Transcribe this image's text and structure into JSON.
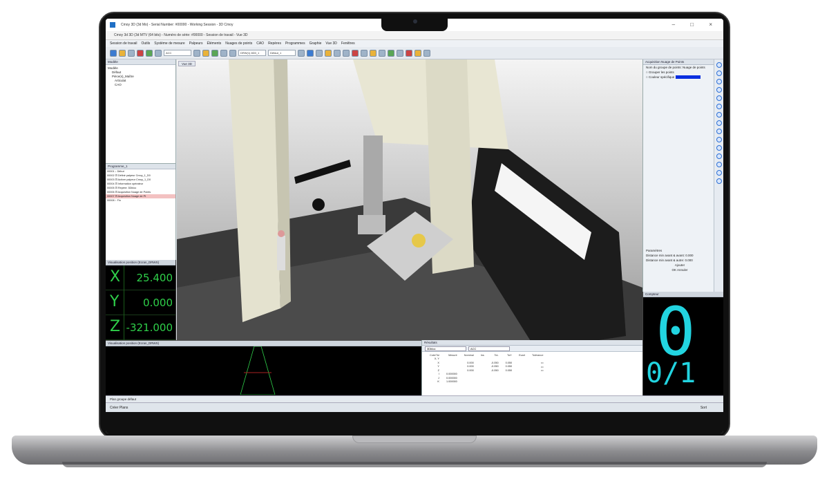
{
  "window": {
    "title": "Cmoy 3D (3d Mo) - Serial Number: #00000 - Working Session - 3D Cmoy",
    "subtitle": "Cmoy 3d 3D (3d MTV (64 bits) - Numéro de série: #00000 - Session de travail - Vue 3D",
    "controls": "– □ ×"
  },
  "menu": [
    "Session de travail",
    "Outils",
    "Système de mesure",
    "Palpeurs",
    "Éléments",
    "Nuages de points",
    "CAO",
    "Repères",
    "Programmes",
    "Graphie",
    "Vue 3D",
    "Fenêtres"
  ],
  "toolbar": {
    "select1": "ACC",
    "select2": "DRW(1) 8D0_1",
    "select3": "Défaut_1"
  },
  "tree_panel": {
    "title": "Modèle",
    "items": [
      "Modèle",
      "Défaut",
      "Pièce(s)_Maître",
      "Articulat",
      "CAO"
    ]
  },
  "program_panel": {
    "title": "Programme_1",
    "rows": [
      "00001  ↓  Début",
      "00002  ⊡  Définir palpeur Cmoy_1_D0",
      "00003  ⊡  Activer palpeur Cmoy_1_D0",
      "00004  ⊡  Information opérateur",
      "00005  ⊡  Repère: 3Dbloc",
      "00006  ⊡  Acquisition Nuage de Points",
      "00007  ⊡  Acquisition Nuage de Pt",
      "00008  ↑  Fin"
    ],
    "selected_index": 6
  },
  "position_panel": {
    "title": "Visualisation position (Ecran_DRWS)",
    "axes": [
      {
        "axis": "X",
        "value": "25.400"
      },
      {
        "axis": "Y",
        "value": "0.000"
      },
      {
        "axis": "Z",
        "value": "-321.000"
      }
    ]
  },
  "view": {
    "tab": "Vue 3D"
  },
  "properties": {
    "title": "Acquisition Nuage de Points",
    "rows": [
      "Nom du groupe de points:  Nuage de points",
      "○ Grouper les points",
      "○ Couleur spécifique",
      "Paramètres",
      "Distance min avant & avant:  0.000",
      "Distance min avant & autre:  0.000",
      "Ajouter",
      "OK   Annuler"
    ],
    "color_swatch": "#0a2fe0"
  },
  "counter": {
    "title": "Compteur",
    "digit": "0",
    "ratio": "0/1",
    "color": "#22d4e0"
  },
  "viz_panel": {
    "title": "Visualisation position (Ecran_DRWS)"
  },
  "results": {
    "title": "Résultats",
    "select1": "3Dbloc",
    "select2": "ACC",
    "headers": [
      "Cote/Tol",
      "Mesuré",
      "Nominal",
      "Ins",
      "Tol-",
      "Tol+",
      "Ecart",
      "Tolérance"
    ],
    "rows": [
      [
        "X, Y",
        "",
        "",
        "",
        "",
        "",
        "",
        ""
      ],
      [
        "X",
        "",
        "0.000",
        "",
        "-0.050",
        "0.050",
        "",
        "▭"
      ],
      [
        "Y",
        "",
        "0.000",
        "",
        "-0.050",
        "0.050",
        "",
        "▭"
      ],
      [
        "Z",
        "",
        "0.000",
        "",
        "-0.050",
        "0.050",
        "",
        "▭"
      ],
      [
        "I",
        "0.000000",
        "",
        "",
        "",
        "",
        "",
        ""
      ],
      [
        "J",
        "0.000000",
        "",
        "",
        "",
        "",
        "",
        ""
      ],
      [
        "K",
        "1.000000",
        "",
        "",
        "",
        "",
        "",
        ""
      ]
    ]
  },
  "status": {
    "left": "Plan groupe défaut",
    "bottom_left": "Créer Plans",
    "bottom_right": "Sort"
  }
}
